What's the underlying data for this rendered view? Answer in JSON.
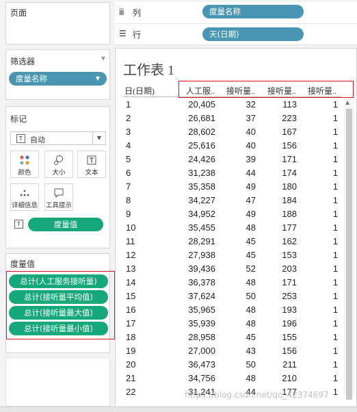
{
  "shelves": {
    "pages_label": "页面",
    "columns_label": "列",
    "rows_label": "行",
    "columns_pill": "度量名称",
    "rows_pill": "天(日期)"
  },
  "filters": {
    "title": "筛选器",
    "pill": "度量名称"
  },
  "marks": {
    "title": "标记",
    "type_value": "自动",
    "buttons": [
      "颜色",
      "大小",
      "文本",
      "详细信息",
      "工具提示"
    ],
    "text_pill": "度量值"
  },
  "measure_values": {
    "title": "度量值",
    "items": [
      "总计(人工服务接听量)",
      "总计(接听量平均值)",
      "总计(接听量最大值)",
      "总计(接听量最小值)"
    ]
  },
  "worksheet": {
    "title": "工作表 1",
    "columns": [
      "日(日期)",
      "人工服..",
      "接听量..",
      "接听量..",
      "接听量.."
    ],
    "rows": [
      [
        "1",
        "20,405",
        "32",
        "113",
        "1"
      ],
      [
        "2",
        "26,681",
        "37",
        "223",
        "1"
      ],
      [
        "3",
        "28,602",
        "40",
        "167",
        "1"
      ],
      [
        "4",
        "25,616",
        "40",
        "156",
        "1"
      ],
      [
        "5",
        "24,426",
        "39",
        "171",
        "1"
      ],
      [
        "6",
        "31,238",
        "44",
        "174",
        "1"
      ],
      [
        "7",
        "35,358",
        "49",
        "180",
        "1"
      ],
      [
        "8",
        "34,227",
        "47",
        "184",
        "1"
      ],
      [
        "9",
        "34,952",
        "49",
        "188",
        "1"
      ],
      [
        "10",
        "35,455",
        "48",
        "177",
        "1"
      ],
      [
        "11",
        "28,291",
        "45",
        "162",
        "1"
      ],
      [
        "12",
        "27,938",
        "45",
        "153",
        "1"
      ],
      [
        "13",
        "39,436",
        "52",
        "203",
        "1"
      ],
      [
        "14",
        "36,378",
        "48",
        "171",
        "1"
      ],
      [
        "15",
        "37,624",
        "50",
        "253",
        "1"
      ],
      [
        "16",
        "35,965",
        "48",
        "193",
        "1"
      ],
      [
        "17",
        "35,939",
        "48",
        "196",
        "1"
      ],
      [
        "18",
        "28,958",
        "45",
        "155",
        "1"
      ],
      [
        "19",
        "27,000",
        "43",
        "156",
        "1"
      ],
      [
        "20",
        "36,473",
        "50",
        "211",
        "1"
      ],
      [
        "21",
        "34,756",
        "48",
        "210",
        "1"
      ],
      [
        "22",
        "31,241",
        "44",
        "177",
        "1"
      ]
    ]
  },
  "watermark": "https://blog.csdn.net/qq_42374697",
  "colors": {
    "dimension_pill": "#4996b2",
    "measure_pill": "#16a87a",
    "highlight": "#d9141c"
  }
}
